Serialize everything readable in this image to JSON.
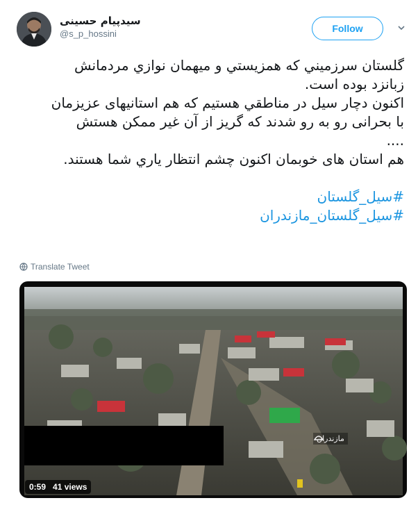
{
  "author": {
    "display_name": "سیدپیام حسینی",
    "handle": "@s_p_hossini"
  },
  "follow_label": "Follow",
  "tweet": {
    "lines": [
      "گلستان سرزميني که همزيستي و ميهمان نوازي مردمانش",
      "زبانزد بوده است.",
      "اکنون دچار سيل در مناطقي هستيم که هم استانيهای عزيزمان",
      "با بحرانی رو به رو شدند که گريز از آن غير ممکن هستش",
      "....",
      "هم استان های خوبمان اکنون چشم انتظار ياري شما هستند."
    ],
    "hashtags": [
      "#سیل_گلستان",
      "#سیل_گلستان_مازندران"
    ]
  },
  "translate_label": "Translate Tweet",
  "video": {
    "channel_label": "مازندران",
    "duration": "0:59",
    "views": "41 views"
  },
  "colors": {
    "link": "#1b95e0",
    "follow": "#1da1f2",
    "muted": "#657786"
  },
  "icons": [
    "globe-icon",
    "chevron-down-icon",
    "channel-logo-icon"
  ]
}
